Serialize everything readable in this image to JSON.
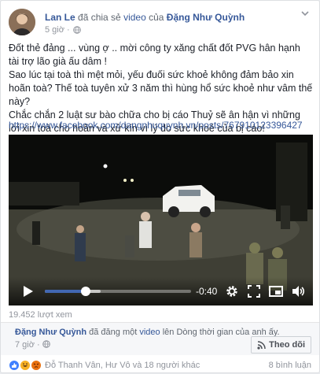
{
  "header": {
    "author": "Lan Le",
    "shared_text": "đã chia sẻ",
    "object_text": "video",
    "of_text": "của",
    "source_name": "Đặng Như Quỳnh",
    "time": "5 giờ ·"
  },
  "post": {
    "lines": [
      "Đốt thẻ đảng ... vùng ợ .. mời công ty xăng chất đốt PVG hân hạnh tài trợ lão già ấu dâm !",
      "Sao lúc tại toà thì mệt mỏi, yếu đuối sức khoẻ không đảm bảo xin hoãn toà? Thế toà tuyên xử 3 năm thì hùng hổ sức khoẻ như vâm thế này?",
      "Chắc chắn 2 luật sư bào chữa cho bị cáo Thuỷ sẽ ân hận vì những lời xin toà cho hoãn và xử kín vì lý do sức khoẻ của bị cáo!"
    ],
    "url": "https://www.facebook.com/dangnhuquynh.vn/posts/767910123396427"
  },
  "video": {
    "time_remaining": "-0:40",
    "progress": 0.28,
    "buffered": 0.38
  },
  "views": "19.452 lượt xem",
  "shared_post": {
    "author": "Đặng Như Quỳnh",
    "action": "đã đăng một",
    "object": "video",
    "rest": "lên Dòng thời gian của anh ấy.",
    "time": "7 giờ ·",
    "follow_label": "Theo dõi"
  },
  "reactions": {
    "names": "Đỗ Thanh Vân, Hư Vô và 18 người khác",
    "comments": "8 bình luận"
  },
  "colors": {
    "link": "#365899",
    "progress": "#4267b2"
  }
}
